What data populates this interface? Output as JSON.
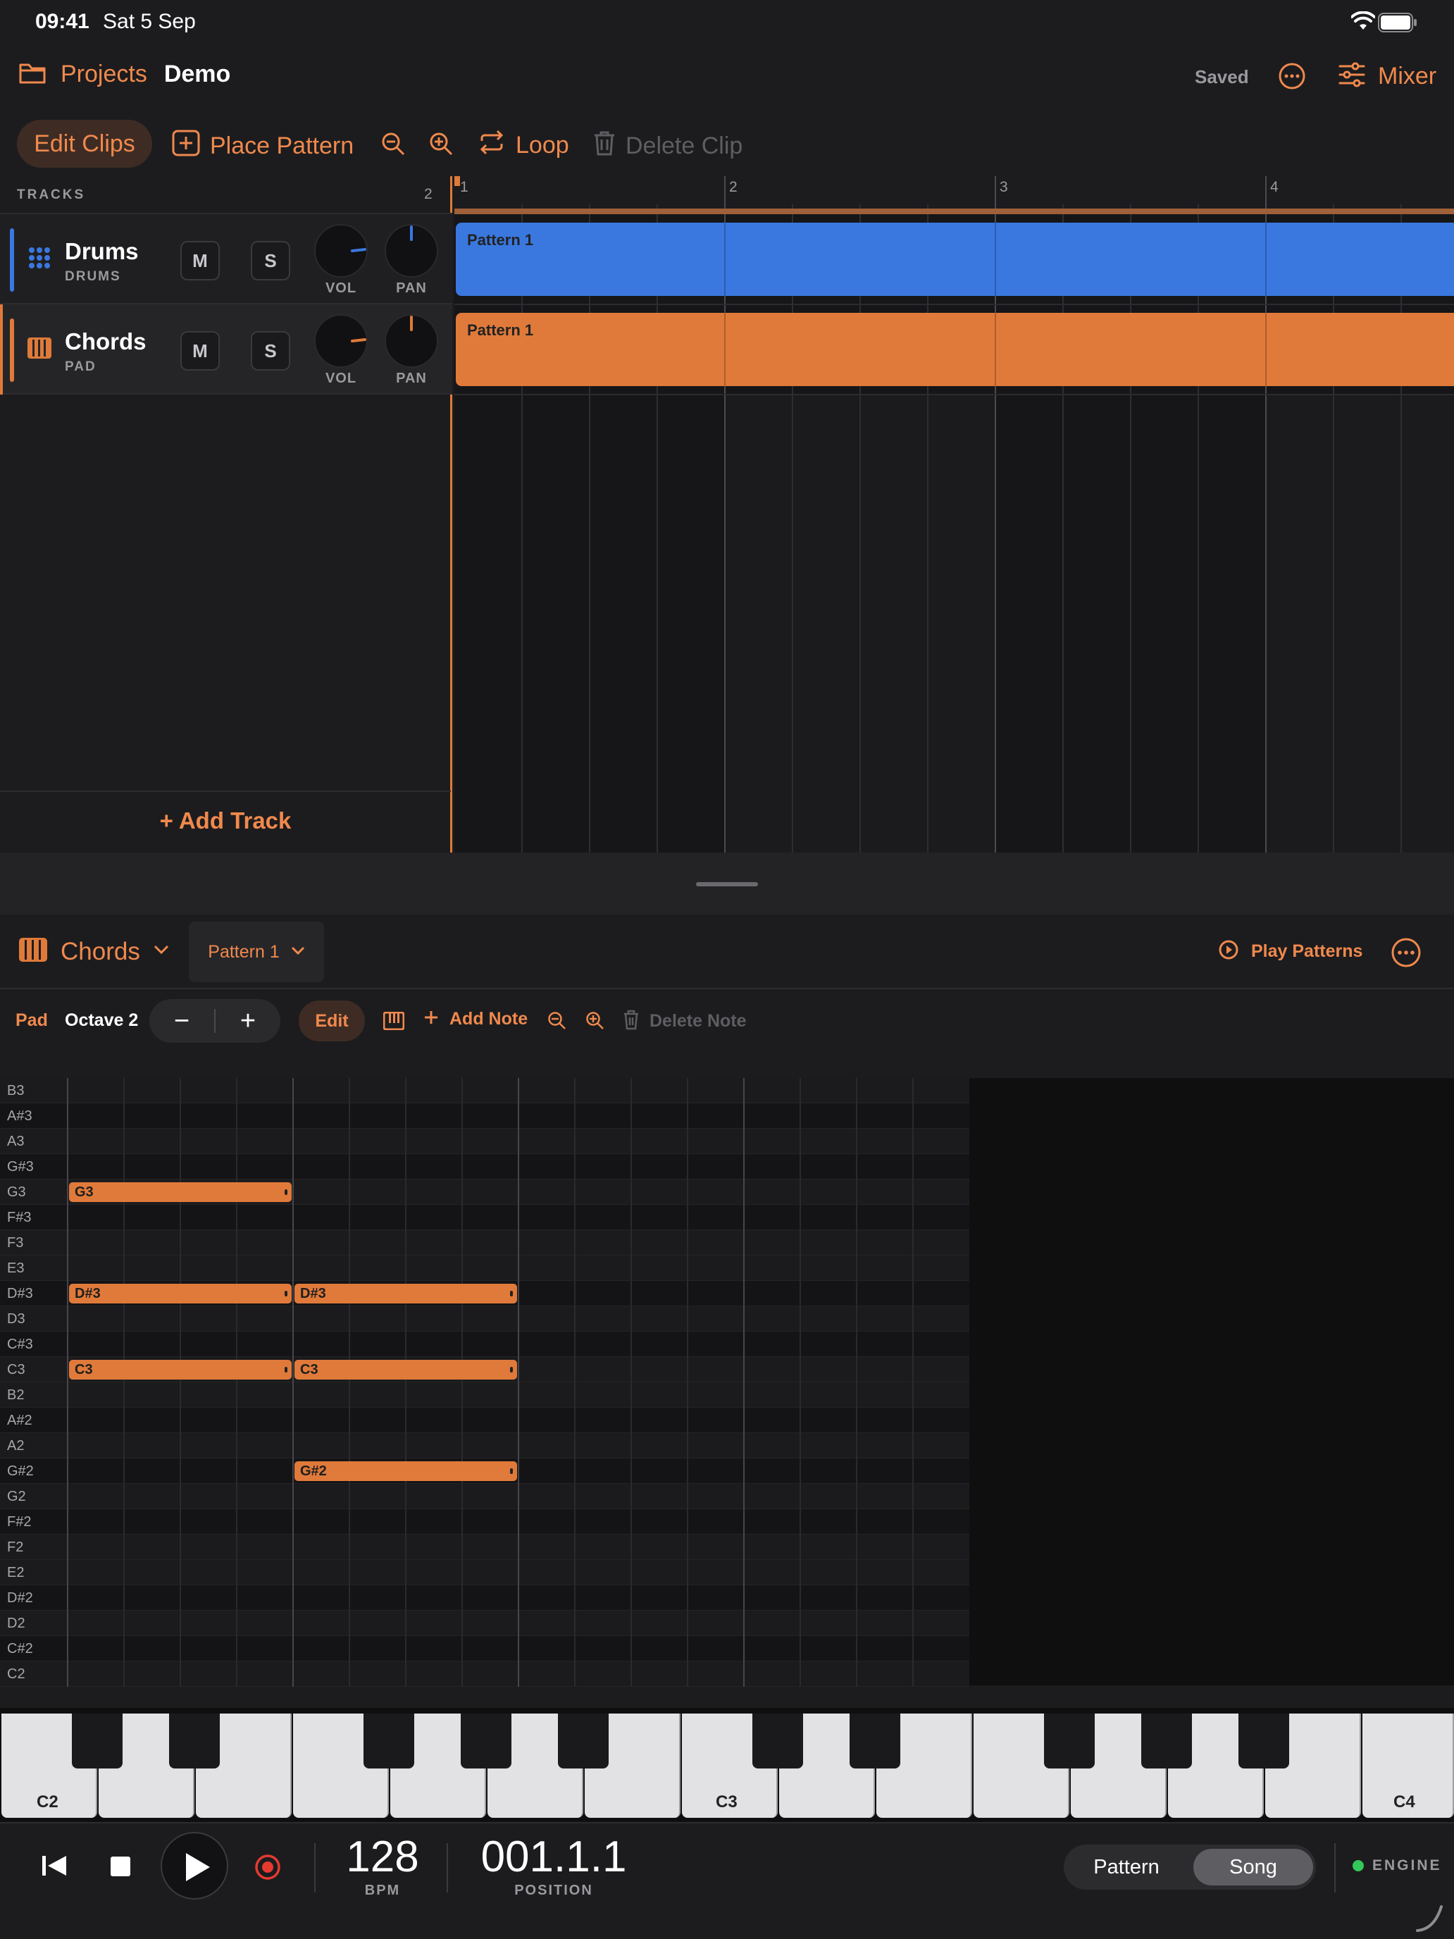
{
  "status_bar": {
    "time": "09:41",
    "date": "Sat 5 Sep"
  },
  "header": {
    "projects_label": "Projects",
    "project_name": "Demo",
    "save_status": "Saved",
    "mixer_label": "Mixer"
  },
  "arrange_toolbar": {
    "edit_clips": "Edit Clips",
    "place_pattern": "Place Pattern",
    "loop": "Loop",
    "delete_clip": "Delete Clip"
  },
  "tracks_panel": {
    "header_label": "TRACKS",
    "track_count": "2",
    "vol_label": "VOL",
    "pan_label": "PAN",
    "mute_label": "M",
    "solo_label": "S",
    "tracks": [
      {
        "name": "Drums",
        "type": "DRUMS",
        "color": "#3a78e0",
        "icon": "drum-pads-icon",
        "vol": 0.75,
        "pan": 0.5
      },
      {
        "name": "Chords",
        "type": "PAD",
        "color": "#e07a3a",
        "icon": "piano-keys-icon",
        "vol": 0.75,
        "pan": 0.5
      }
    ],
    "add_track_label": "+ Add Track"
  },
  "timeline": {
    "bars": [
      "1",
      "2",
      "3",
      "4"
    ],
    "clips": [
      {
        "track": "Drums",
        "label": "Pattern 1",
        "color": "#3a78e0"
      },
      {
        "track": "Chords",
        "label": "Pattern 1",
        "color": "#e07a3a"
      }
    ]
  },
  "editor_header": {
    "instrument": "Chords",
    "pattern": "Pattern 1",
    "play_patterns": "Play Patterns"
  },
  "editor_toolbar": {
    "preset": "Pad",
    "octave": "Octave 2",
    "minus": "−",
    "plus": "+",
    "edit": "Edit",
    "add_note": "Add Note",
    "delete_note": "Delete Note"
  },
  "piano_roll": {
    "pitches": [
      "B3",
      "A#3",
      "A3",
      "G#3",
      "G3",
      "F#3",
      "F3",
      "E3",
      "D#3",
      "D3",
      "C#3",
      "C3",
      "B2",
      "A#2",
      "A2",
      "G#2",
      "G2",
      "F#2",
      "F2",
      "E2",
      "D#2",
      "D2",
      "C#2",
      "C2"
    ],
    "notes": [
      {
        "pitch": "G3",
        "start": 0,
        "length": 8,
        "label": "G3"
      },
      {
        "pitch": "D#3",
        "start": 0,
        "length": 8,
        "label": "D#3"
      },
      {
        "pitch": "D#3",
        "start": 8,
        "length": 8,
        "label": "D#3"
      },
      {
        "pitch": "C3",
        "start": 0,
        "length": 8,
        "label": "C3"
      },
      {
        "pitch": "C3",
        "start": 8,
        "length": 8,
        "label": "C3"
      },
      {
        "pitch": "G#2",
        "start": 8,
        "length": 8,
        "label": "G#2"
      }
    ]
  },
  "keyboard": {
    "labels": [
      "C2",
      "C3",
      "C4"
    ]
  },
  "transport": {
    "bpm": "128",
    "bpm_label": "BPM",
    "position": "001.1.1",
    "position_label": "POSITION",
    "mode_pattern": "Pattern",
    "mode_song": "Song",
    "active_mode": "Song",
    "engine_label": "ENGINE"
  }
}
